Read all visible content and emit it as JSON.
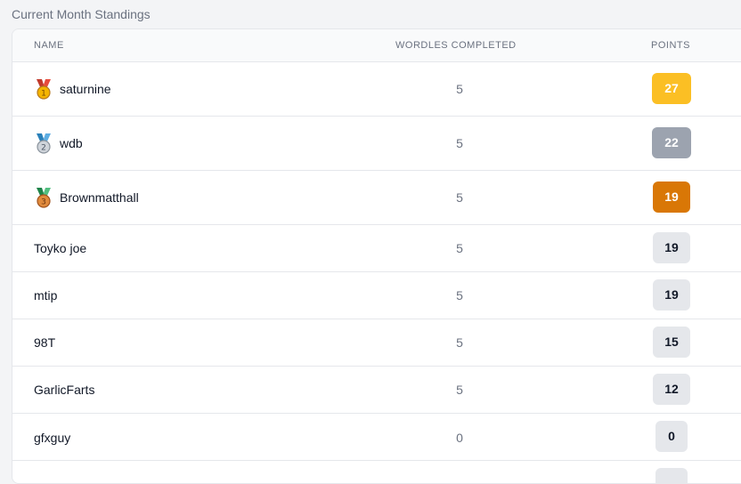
{
  "section_title": "Current Month Standings",
  "table": {
    "headers": {
      "name": "NAME",
      "wordles": "WORDLES COMPLETED",
      "points": "POINTS"
    },
    "rows": [
      {
        "name": "saturnine",
        "wordles": "5",
        "points": "27",
        "medal": "gold-medal-icon",
        "pts_color": "#fbbf24"
      },
      {
        "name": "wdb",
        "wordles": "5",
        "points": "22",
        "medal": "silver-medal-icon",
        "pts_color": "#9ca3af"
      },
      {
        "name": "Brownmatthall",
        "wordles": "5",
        "points": "19",
        "medal": "bronze-medal-icon",
        "pts_color": "#d97706"
      },
      {
        "name": "Toyko joe",
        "wordles": "5",
        "points": "19"
      },
      {
        "name": "mtip",
        "wordles": "5",
        "points": "19"
      },
      {
        "name": "98T",
        "wordles": "5",
        "points": "15"
      },
      {
        "name": "GarlicFarts",
        "wordles": "5",
        "points": "12"
      },
      {
        "name": "gfxguy",
        "wordles": "0",
        "points": "0"
      }
    ]
  }
}
